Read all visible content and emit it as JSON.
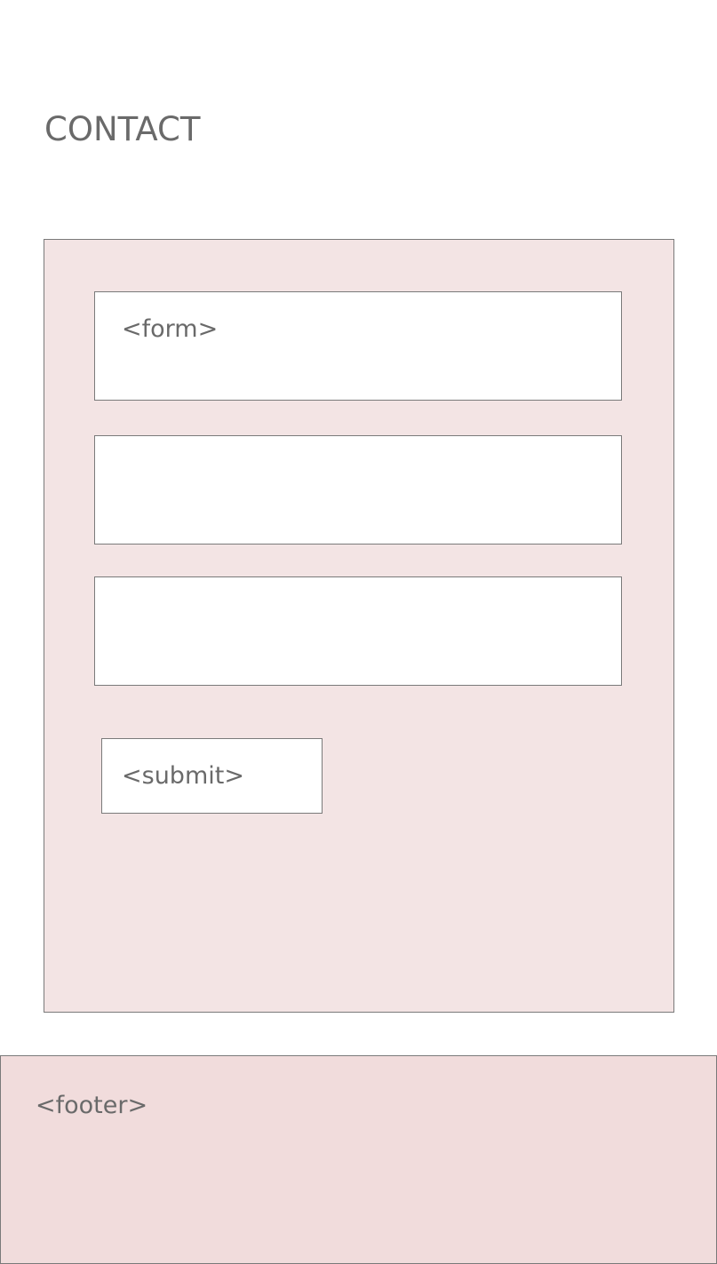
{
  "header": {
    "title": "CONTACT"
  },
  "form": {
    "fields": [
      {
        "label": "<form>"
      },
      {
        "label": ""
      },
      {
        "label": ""
      }
    ],
    "submit_label": "<submit>"
  },
  "footer": {
    "label": "<footer>"
  },
  "colors": {
    "form_panel_bg": "#f3e4e4",
    "footer_bg": "#f1dcdc",
    "border": "#7a7a7a",
    "text": "#6a6a6a"
  }
}
